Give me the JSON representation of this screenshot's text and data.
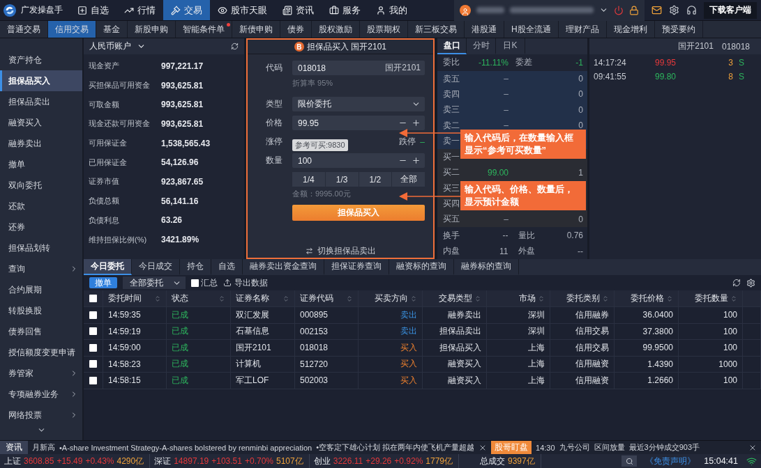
{
  "top_bar": {
    "app_name": "广发操盘手",
    "nav": [
      {
        "label": "自选",
        "selected": false
      },
      {
        "label": "行情",
        "selected": false
      },
      {
        "label": "交易",
        "selected": true
      },
      {
        "label": "股市天眼",
        "selected": false
      },
      {
        "label": "资讯",
        "selected": false
      },
      {
        "label": "服务",
        "selected": false
      },
      {
        "label": "我的",
        "selected": false
      }
    ],
    "download_button": "下载客户端"
  },
  "sub_tabs": [
    {
      "label": "普通交易",
      "selected": false,
      "dot": false
    },
    {
      "label": "信用交易",
      "selected": true,
      "dot": false
    },
    {
      "label": "基金",
      "selected": false,
      "dot": false
    },
    {
      "label": "新股申购",
      "selected": false,
      "dot": false
    },
    {
      "label": "智能条件单",
      "selected": false,
      "dot": true
    },
    {
      "label": "新债申购",
      "selected": false,
      "dot": false
    },
    {
      "label": "债券",
      "selected": false,
      "dot": false
    },
    {
      "label": "股权激励",
      "selected": false,
      "dot": false
    },
    {
      "label": "股票期权",
      "selected": false,
      "dot": false
    },
    {
      "label": "新三板交易",
      "selected": false,
      "dot": false
    },
    {
      "label": "港股通",
      "selected": false,
      "dot": false
    },
    {
      "label": "H股全流通",
      "selected": false,
      "dot": false
    },
    {
      "label": "理财产品",
      "selected": false,
      "dot": false
    },
    {
      "label": "现金增利",
      "selected": false,
      "dot": false
    },
    {
      "label": "预受要约",
      "selected": false,
      "dot": false
    }
  ],
  "sidebar": {
    "items": [
      {
        "label": "资产持仓",
        "selected": false,
        "has_submenu": false
      },
      {
        "label": "担保品买入",
        "selected": true,
        "has_submenu": false
      },
      {
        "label": "担保品卖出",
        "selected": false,
        "has_submenu": false
      },
      {
        "label": "融资买入",
        "selected": false,
        "has_submenu": false
      },
      {
        "label": "融券卖出",
        "selected": false,
        "has_submenu": false
      },
      {
        "label": "撤单",
        "selected": false,
        "has_submenu": false
      },
      {
        "label": "双向委托",
        "selected": false,
        "has_submenu": false
      },
      {
        "label": "还款",
        "selected": false,
        "has_submenu": false
      },
      {
        "label": "还券",
        "selected": false,
        "has_submenu": false
      },
      {
        "label": "担保品划转",
        "selected": false,
        "has_submenu": false
      },
      {
        "label": "查询",
        "selected": false,
        "has_submenu": true
      },
      {
        "label": "合约展期",
        "selected": false,
        "has_submenu": false
      },
      {
        "label": "转股换股",
        "selected": false,
        "has_submenu": false
      },
      {
        "label": "债券回售",
        "selected": false,
        "has_submenu": false
      },
      {
        "label": "授信额度变更申请",
        "selected": false,
        "has_submenu": false
      },
      {
        "label": "券管家",
        "selected": false,
        "has_submenu": true
      },
      {
        "label": "专项融券业务",
        "selected": false,
        "has_submenu": true
      },
      {
        "label": "网络投票",
        "selected": false,
        "has_submenu": true
      }
    ]
  },
  "account": {
    "title": "人民币账户",
    "rows": [
      {
        "label": "现金资产",
        "value": "997,221.17"
      },
      {
        "label": "买担保品可用资金",
        "value": "993,625.81"
      },
      {
        "label": "可取金额",
        "value": "993,625.81"
      },
      {
        "label": "现金还款可用资金",
        "value": "993,625.81"
      },
      {
        "label": "可用保证金",
        "value": "1,538,565.43"
      },
      {
        "label": "已用保证金",
        "value": "54,126.96"
      },
      {
        "label": "证券市值",
        "value": "923,867.65"
      },
      {
        "label": "负债总额",
        "value": "56,141.16"
      },
      {
        "label": "负债利息",
        "value": "63.26"
      },
      {
        "label": "维持担保比例(%)",
        "value": "3421.89%"
      }
    ]
  },
  "order_form": {
    "badge": "B",
    "title": "担保品买入 国开2101",
    "code_label": "代码",
    "code": "018018",
    "code_name": "国开2101",
    "rate_hint": "折算率 95%",
    "type_label": "类型",
    "type": "限价委托",
    "price_label": "价格",
    "price": "99.95",
    "limit_up_label": "涨停",
    "limit_down_label": "跌停",
    "limit_down_value": "–",
    "reference_tooltip": "参考可买:9830",
    "quantity_label": "数量",
    "quantity": "100",
    "quick_buttons": [
      "1/4",
      "1/3",
      "1/2",
      "全部"
    ],
    "amount": "金额：9995.00元",
    "submit": "担保品买入",
    "switch_link": "切换担保品卖出"
  },
  "quote": {
    "tabs": [
      {
        "label": "盘口",
        "selected": true
      },
      {
        "label": "分时",
        "selected": false
      },
      {
        "label": "日K",
        "selected": false
      }
    ],
    "security_name": "国开2101",
    "security_code": "018018",
    "summary": [
      {
        "label": "委比",
        "value": "-11.11%",
        "color": "#2db55d"
      },
      {
        "label": "委差",
        "value": "-1",
        "color": "#2db55d"
      }
    ],
    "book": [
      {
        "label": "卖五",
        "price": "–",
        "volume": "0",
        "kind": "sell"
      },
      {
        "label": "卖四",
        "price": "–",
        "volume": "0",
        "kind": "sell"
      },
      {
        "label": "卖三",
        "price": "–",
        "volume": "0",
        "kind": "sell"
      },
      {
        "label": "卖二",
        "price": "–",
        "volume": "0",
        "kind": "sell"
      },
      {
        "label": "卖一",
        "kind": "sell"
      },
      {
        "label": "买一",
        "kind": "buy"
      },
      {
        "label": "买二",
        "price": "99.00",
        "volume": "1",
        "kind": "buy",
        "color": "#2db55d"
      },
      {
        "label": "买三",
        "kind": "buy"
      },
      {
        "label": "买四",
        "kind": "buy"
      },
      {
        "label": "买五",
        "price": "–",
        "volume": "0",
        "kind": "buy"
      }
    ],
    "stats": [
      {
        "label": "换手",
        "value": "--"
      },
      {
        "label": "量比",
        "value": "0.76"
      },
      {
        "label": "内盘",
        "value": "11"
      },
      {
        "label": "外盘",
        "value": "--"
      }
    ],
    "ticks": [
      {
        "time": "14:17:24",
        "price": "99.95",
        "color": "#e5393b",
        "volume": "3",
        "flag": "S"
      },
      {
        "time": "09:41:55",
        "price": "99.80",
        "color": "#2db55d",
        "volume": "8",
        "flag": "S"
      }
    ]
  },
  "callouts": [
    {
      "text": "输入代码后，在数量输入框显示“参考可买数量”"
    },
    {
      "text": "输入代码、价格、数量后，显示预计金额"
    }
  ],
  "orders": {
    "tabs": [
      {
        "label": "今日委托",
        "selected": true
      },
      {
        "label": "今日成交",
        "selected": false
      },
      {
        "label": "持仓",
        "selected": false
      },
      {
        "label": "自选",
        "selected": false
      },
      {
        "label": "融券卖出资金查询",
        "selected": false
      },
      {
        "label": "担保证券查询",
        "selected": false
      },
      {
        "label": "融资标的查询",
        "selected": false
      },
      {
        "label": "融券标的查询",
        "selected": false
      }
    ],
    "cancel_button": "撤单",
    "filter": "全部委托",
    "summary_label": "汇总",
    "summary_checked": false,
    "export": "导出数据",
    "header_checked": false,
    "columns": [
      "委托时间",
      "状态",
      "证券名称",
      "证券代码",
      "买卖方向",
      "交易类型",
      "市场",
      "委托类别",
      "委托价格",
      "委托数量"
    ],
    "rows": [
      {
        "checked": false,
        "kind": "sell",
        "cells": [
          "14:59:35",
          "已成",
          "双汇发展",
          "000895",
          "卖出",
          "融券卖出",
          "深圳",
          "信用融券",
          "36.0400",
          "100"
        ]
      },
      {
        "checked": false,
        "kind": "sell",
        "cells": [
          "14:59:19",
          "已成",
          "石基信息",
          "002153",
          "卖出",
          "担保品卖出",
          "深圳",
          "信用交易",
          "37.3800",
          "100"
        ]
      },
      {
        "checked": false,
        "kind": "buy",
        "cells": [
          "14:59:00",
          "已成",
          "国开2101",
          "018018",
          "买入",
          "担保品买入",
          "上海",
          "信用交易",
          "99.9500",
          "100"
        ]
      },
      {
        "checked": false,
        "kind": "buy",
        "cells": [
          "14:58:23",
          "已成",
          "计算机",
          "512720",
          "买入",
          "融资买入",
          "上海",
          "信用融资",
          "1.4390",
          "1000"
        ]
      },
      {
        "checked": false,
        "kind": "buy",
        "cells": [
          "14:58:15",
          "已成",
          "军工LOF",
          "502003",
          "买入",
          "融资买入",
          "上海",
          "信用融资",
          "1.2660",
          "100"
        ]
      }
    ]
  },
  "news_ticker": {
    "label": "资讯",
    "items": [
      "月新高",
      "•A-share Investment Strategy-A-shares bolstered by renminbi appreciation",
      "•空客定下雄心计划 拟在两年内使飞机产量超越"
    ],
    "alert_tag": "股哥盯盘",
    "alert_items": [
      "14:30",
      "九号公司",
      "区间放量",
      "最近3分钟成交903手"
    ]
  },
  "index_bar": {
    "indices": [
      {
        "name": "上证",
        "price": "3608.85",
        "change": "+15.49",
        "percent": "+0.43%",
        "amount": "4290亿",
        "color": "#e5393b"
      },
      {
        "name": "深证",
        "price": "14897.19",
        "change": "+103.51",
        "percent": "+0.70%",
        "amount": "5107亿",
        "color": "#e5393b"
      },
      {
        "name": "创业",
        "price": "3226.11",
        "change": "+29.26",
        "percent": "+0.92%",
        "amount": "1779亿",
        "color": "#e5393b"
      }
    ],
    "total_label": "总成交",
    "total": "9397亿",
    "disclaimer": "《免责声明》",
    "time": "15:04:41"
  }
}
